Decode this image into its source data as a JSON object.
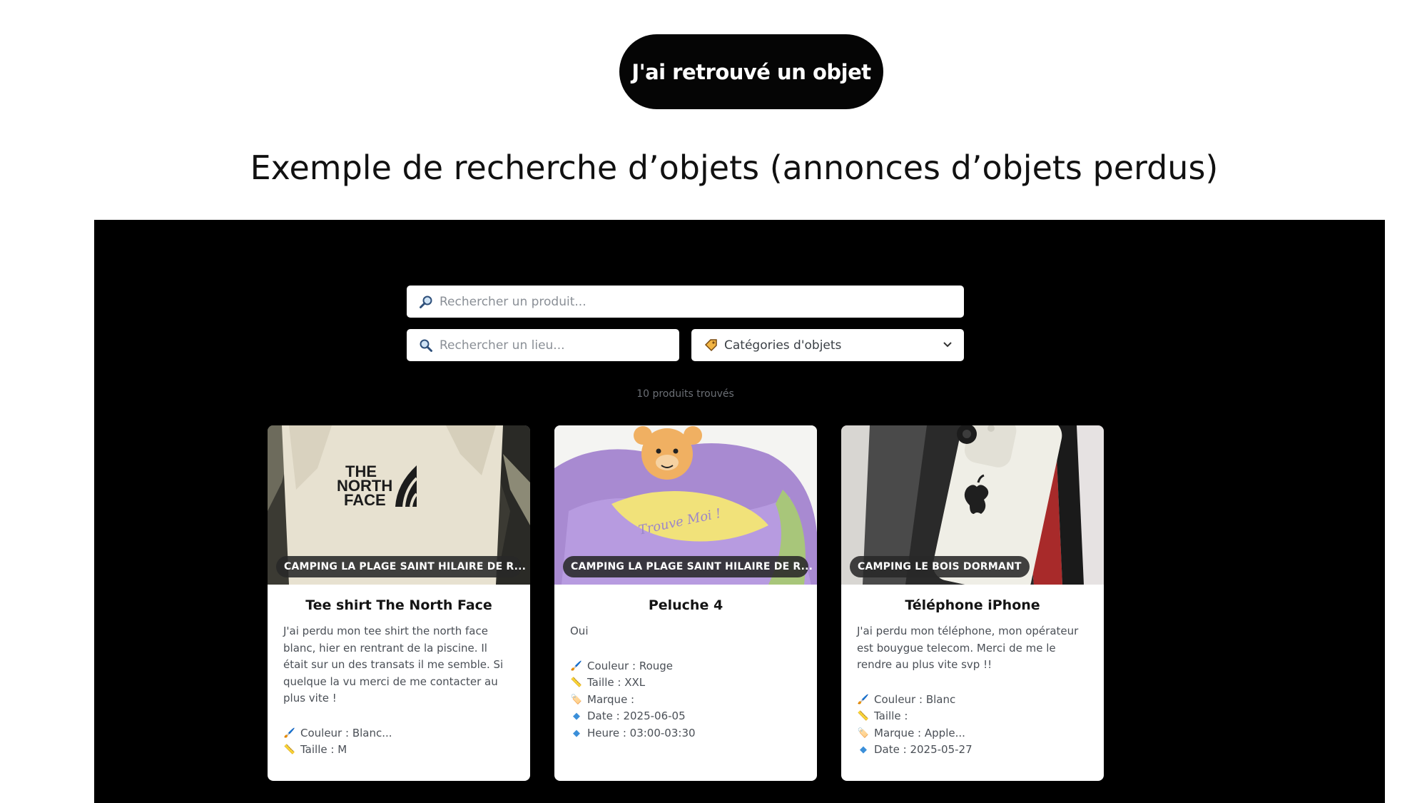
{
  "cta": {
    "label": "J'ai retrouvé un objet"
  },
  "slide_title": "Exemple de recherche d’objets (annonces d’objets perdus)",
  "search": {
    "product_placeholder": "Rechercher un produit...",
    "place_placeholder": "Rechercher un lieu...",
    "category_label": "Catégories d'objets",
    "result_count": "10 produits trouvés"
  },
  "icons": {
    "product": "magnifier-right-icon",
    "place": "magnifier-left-icon",
    "category": "label-tag-icon",
    "color": "paintbrush-icon",
    "size": "ruler-icon",
    "brand": "label-tag-icon",
    "date": "diamond-icon",
    "time": "diamond-icon"
  },
  "colors": {
    "background": "#000000",
    "badge": "#282828",
    "card": "#ffffff"
  },
  "cards": [
    {
      "location": "CAMPING LA PLAGE SAINT HILAIRE DE R...",
      "title": "Tee shirt The North Face",
      "description": "J'ai perdu mon tee shirt the north face blanc, hier en rentrant de la piscine. Il était sur un des transats il me semble. Si quelque la vu merci de me contacter au plus vite !",
      "attributes": {
        "color": "Couleur : Blanc...",
        "size": "Taille : M"
      },
      "photo_text": [
        "THE",
        "NORTH",
        "FACE"
      ]
    },
    {
      "location": "CAMPING LA PLAGE SAINT HILAIRE DE R...",
      "title": "Peluche 4",
      "description": "Oui",
      "attributes": {
        "color": "Couleur : Rouge",
        "size": "Taille : XXL",
        "brand": "Marque :",
        "date": "Date : 2025-06-05",
        "time": "Heure : 03:00-03:30"
      },
      "photo_text": "Trouve Moi !"
    },
    {
      "location": "CAMPING LE BOIS DORMANT",
      "title": "Téléphone iPhone",
      "description": "J'ai perdu mon téléphone, mon opérateur est bouygue telecom. Merci de me le rendre au plus vite svp !!",
      "attributes": {
        "color": "Couleur : Blanc",
        "size": "Taille :",
        "brand": "Marque : Apple...",
        "date": "Date : 2025-05-27"
      }
    }
  ]
}
